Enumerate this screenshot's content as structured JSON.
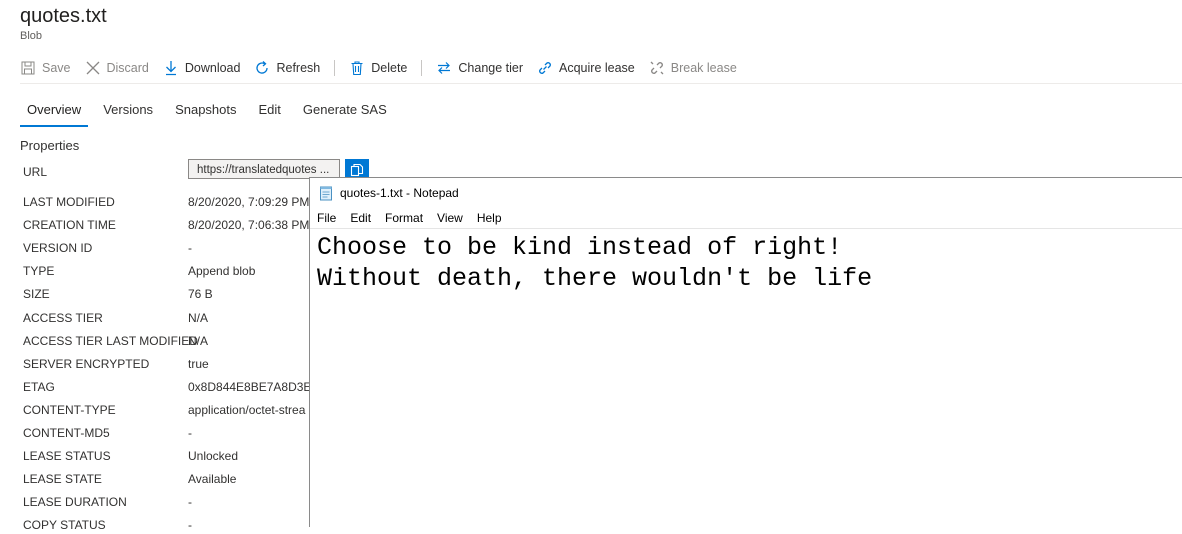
{
  "header": {
    "title": "quotes.txt",
    "subtitle": "Blob"
  },
  "toolbar": {
    "save": "Save",
    "discard": "Discard",
    "download": "Download",
    "refresh": "Refresh",
    "delete": "Delete",
    "change_tier": "Change tier",
    "acquire_lease": "Acquire lease",
    "break_lease": "Break lease"
  },
  "tabs": [
    "Overview",
    "Versions",
    "Snapshots",
    "Edit",
    "Generate SAS"
  ],
  "properties": {
    "title": "Properties",
    "url_label": "URL",
    "url_value": "https://translatedquotes ...",
    "rows": [
      {
        "key": "LAST MODIFIED",
        "value": "8/20/2020, 7:09:29 PM"
      },
      {
        "key": "CREATION TIME",
        "value": "8/20/2020, 7:06:38 PM"
      },
      {
        "key": "VERSION ID",
        "value": "-"
      },
      {
        "key": "TYPE",
        "value": "Append blob"
      },
      {
        "key": "SIZE",
        "value": "76 B"
      },
      {
        "key": "ACCESS TIER",
        "value": "N/A"
      },
      {
        "key": "ACCESS TIER LAST MODIFIED",
        "value": "N/A"
      },
      {
        "key": "SERVER ENCRYPTED",
        "value": "true"
      },
      {
        "key": "ETAG",
        "value": "0x8D844E8BE7A8D3E"
      },
      {
        "key": "CONTENT-TYPE",
        "value": "application/octet-strea"
      },
      {
        "key": "CONTENT-MD5",
        "value": "-"
      },
      {
        "key": "LEASE STATUS",
        "value": "Unlocked"
      },
      {
        "key": "LEASE STATE",
        "value": "Available"
      },
      {
        "key": "LEASE DURATION",
        "value": "-"
      },
      {
        "key": "COPY STATUS",
        "value": "-"
      }
    ]
  },
  "notepad": {
    "title": "quotes-1.txt - Notepad",
    "menu": [
      "File",
      "Edit",
      "Format",
      "View",
      "Help"
    ],
    "lines": [
      "Choose to be kind instead of right!",
      "Without death, there wouldn't be life"
    ]
  },
  "colors": {
    "accent": "#0078d4",
    "disabled": "#8a8886"
  }
}
